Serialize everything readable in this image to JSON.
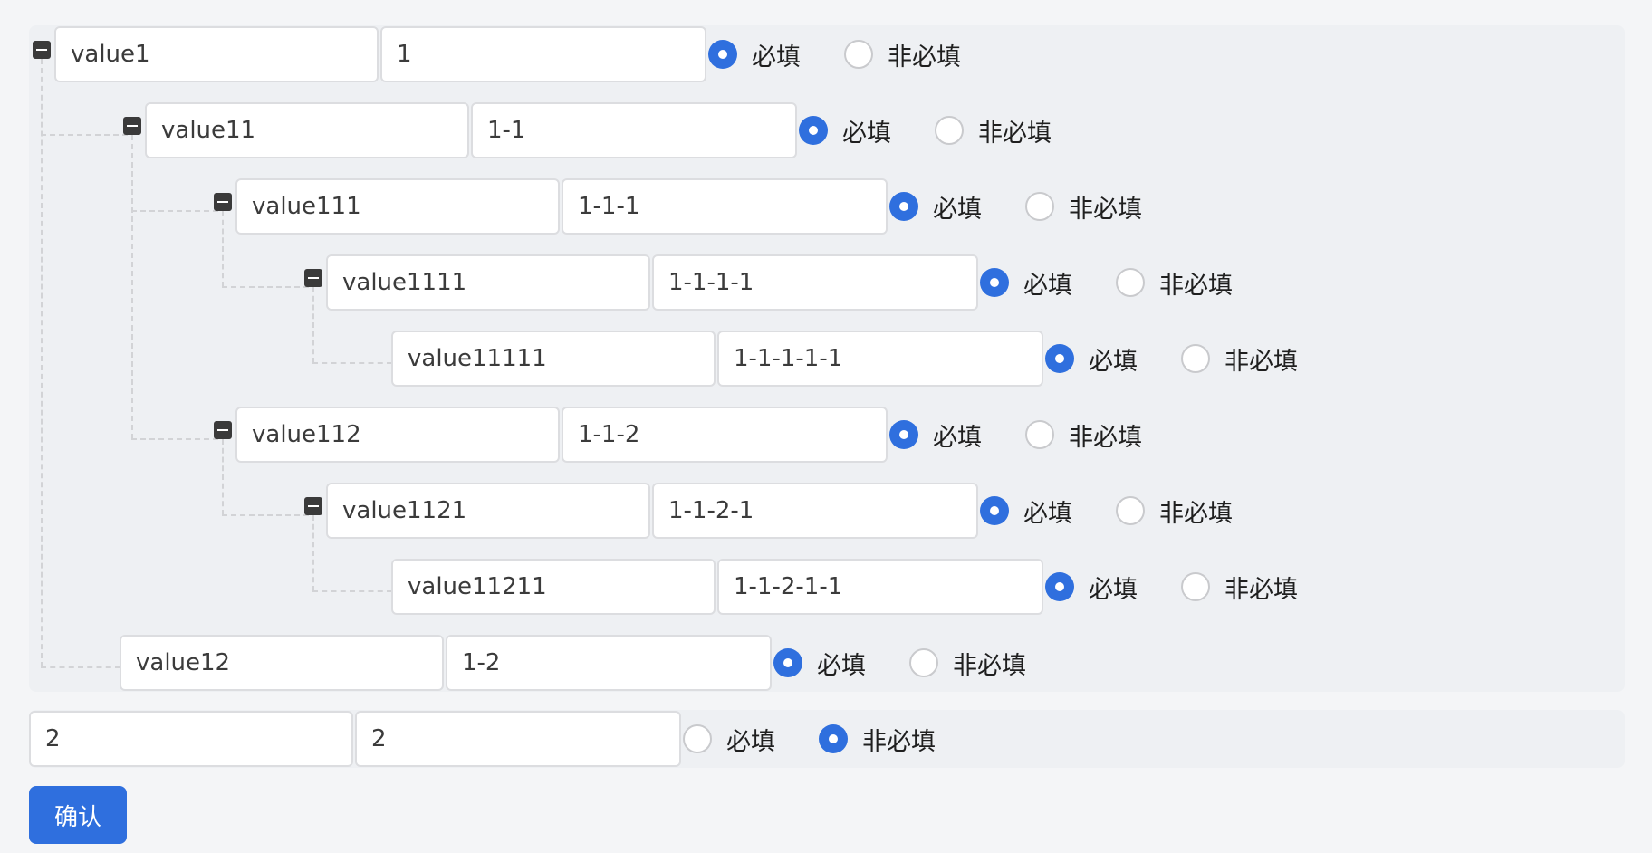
{
  "radio_labels": {
    "required": "必填",
    "optional": "非必填"
  },
  "tree": [
    {
      "key": "value1",
      "value": "1",
      "required": true
    },
    {
      "key": "value11",
      "value": "1-1",
      "required": true
    },
    {
      "key": "value111",
      "value": "1-1-1",
      "required": true
    },
    {
      "key": "value1111",
      "value": "1-1-1-1",
      "required": true
    },
    {
      "key": "value11111",
      "value": "1-1-1-1-1",
      "required": true
    },
    {
      "key": "value112",
      "value": "1-1-2",
      "required": true
    },
    {
      "key": "value1121",
      "value": "1-1-2-1",
      "required": true
    },
    {
      "key": "value11211",
      "value": "1-1-2-1-1",
      "required": true
    },
    {
      "key": "value12",
      "value": "1-2",
      "required": true
    }
  ],
  "second_row": {
    "key": "2",
    "value": "2",
    "required": false
  },
  "confirm_button": "确认",
  "colors": {
    "accent": "#2f6fde",
    "panel": "#eef0f3",
    "background": "#f4f5f7"
  }
}
